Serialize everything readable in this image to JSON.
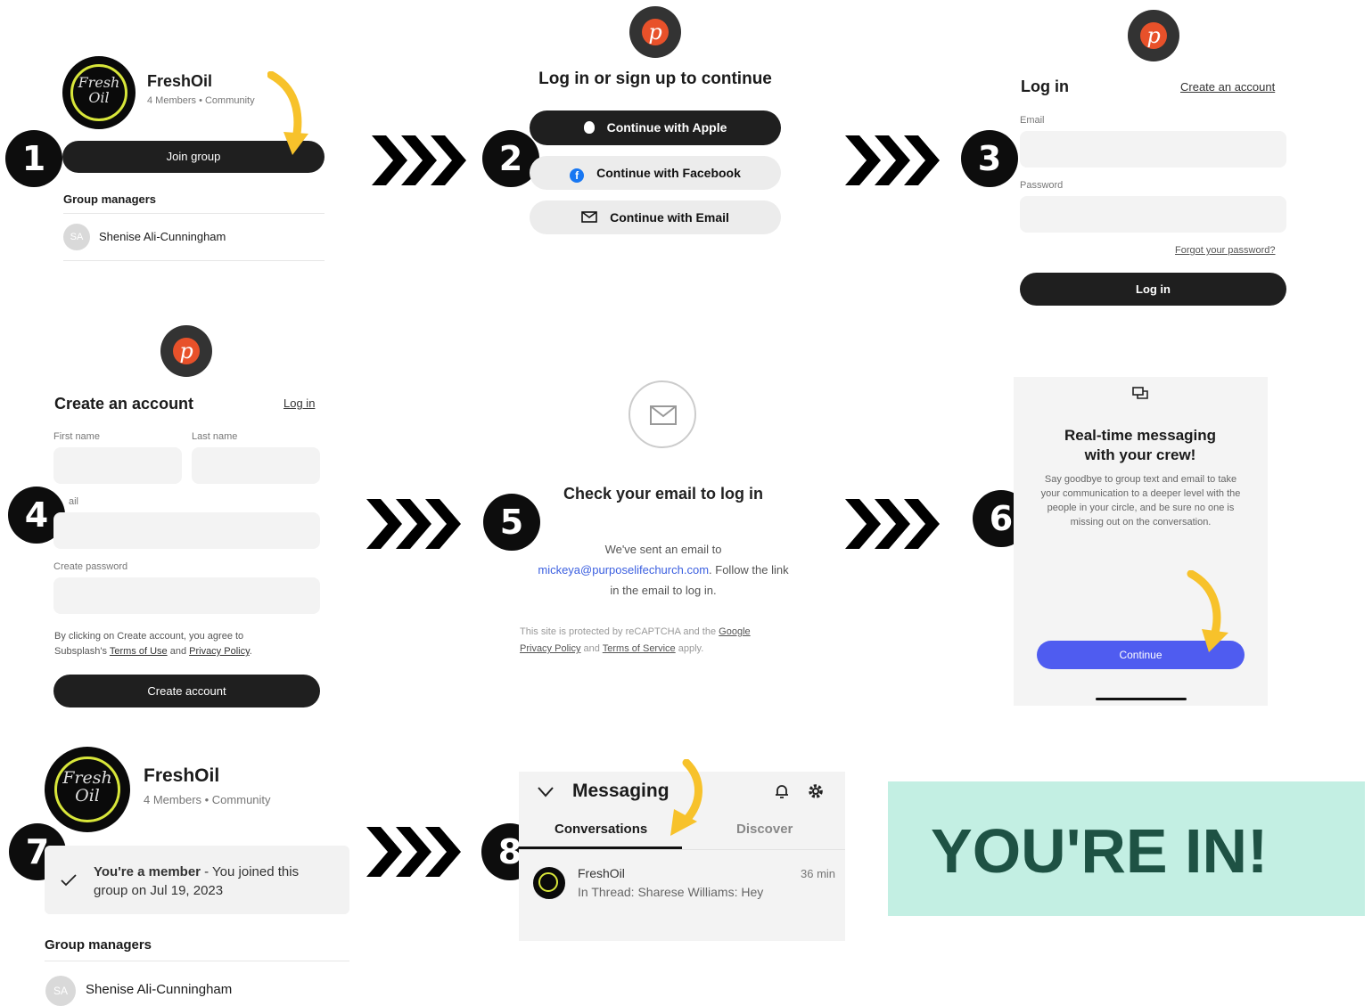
{
  "steps": [
    "1",
    "2",
    "3",
    "4",
    "5",
    "6",
    "7",
    "8"
  ],
  "panel1": {
    "logo_line1": "Fresh",
    "logo_line2": "Oil",
    "name": "FreshOil",
    "meta": "4 Members • Community",
    "join_label": "Join group",
    "managers_title": "Group managers",
    "manager_initials": "SA",
    "manager_name": "Shenise Ali-Cunningham"
  },
  "panel2": {
    "brand_letter": "p",
    "title": "Log in or sign up to continue",
    "apple": "Continue with Apple",
    "facebook": "Continue with Facebook",
    "email": "Continue with Email"
  },
  "panel3": {
    "brand_letter": "p",
    "title": "Log in",
    "create_link": "Create an account",
    "email_label": "Email",
    "password_label": "Password",
    "forgot": "Forgot your password?",
    "login_button": "Log in"
  },
  "panel4": {
    "brand_letter": "p",
    "title": "Create an account",
    "login_link": "Log in",
    "first_name": "First name",
    "last_name": "Last name",
    "email_label": "ail",
    "create_password": "Create password",
    "terms_prefix": "By clicking on Create account, you agree to",
    "terms_mid": "Subsplash's",
    "terms_link": "Terms of Use",
    "and": "and",
    "privacy_link": "Privacy Policy",
    "period": ".",
    "create_button": "Create account"
  },
  "panel5": {
    "title": "Check your email to log in",
    "line1": "We've sent an email to",
    "email": "mickeya@purposelifechurch.com",
    "line2_rest": ". Follow the link",
    "line3": "in the email to log in.",
    "recaptcha_prefix": "This site is protected by reCAPTCHA and the",
    "google": "Google",
    "privacy": "Privacy Policy",
    "and": "and",
    "terms": "Terms of Service",
    "apply": "apply."
  },
  "panel6": {
    "title_line1": "Real-time messaging",
    "title_line2": "with your crew!",
    "body": "Say goodbye to group text and email to take your communication to a deeper level with the people in your circle, and be sure no one is missing out on the conversation.",
    "continue": "Continue"
  },
  "panel7": {
    "logo_line1": "Fresh",
    "logo_line2": "Oil",
    "name": "FreshOil",
    "meta": "4 Members • Community",
    "member_bold": "You're a member",
    "member_rest": " - You joined this",
    "member_line2": "group on Jul 19, 2023",
    "managers_title": "Group managers",
    "manager_initials": "SA",
    "manager_name": "Shenise Ali-Cunningham"
  },
  "panel8": {
    "title": "Messaging",
    "tab_conversations": "Conversations",
    "tab_discover": "Discover",
    "thread_name": "FreshOil",
    "thread_time": "36 min",
    "thread_preview": "In Thread: Sharese Williams: Hey"
  },
  "banner": {
    "text": "YOU'RE IN!",
    "bg": "#c3efe3",
    "color": "#1e5244"
  },
  "colors": {
    "accent_yellow": "#f7c22b",
    "continue_blue": "#4f5cf0",
    "brand_orange": "#e8512a"
  },
  "icons": [
    "apple-icon",
    "facebook-icon",
    "mail-icon",
    "check-icon",
    "chevron-down-icon",
    "bell-icon",
    "gear-icon",
    "chat-icon",
    "chevron-arrows-icon",
    "curved-arrow-icon"
  ]
}
